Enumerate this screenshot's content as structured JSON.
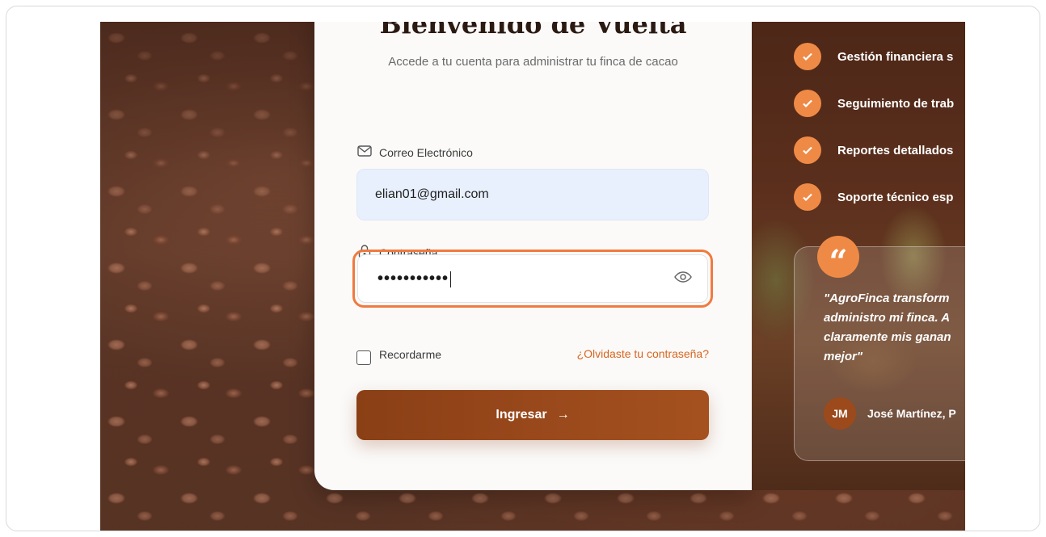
{
  "login": {
    "title": "Bienvenido de Vuelta",
    "subtitle": "Accede a tu cuenta para administrar tu finca de cacao",
    "email_label": "Correo Electrónico",
    "email_value": "elian01@gmail.com",
    "password_label": "Contraseña",
    "password_mask": "•••••••••••",
    "remember_label": "Recordarme",
    "forgot_label": "¿Olvidaste tu contraseña?",
    "submit_label": "Ingresar",
    "submit_arrow": "→"
  },
  "features": [
    {
      "label": "Gestión financiera s"
    },
    {
      "label": "Seguimiento de trab"
    },
    {
      "label": "Reportes detallados"
    },
    {
      "label": "Soporte técnico esp"
    }
  ],
  "testimonial": {
    "quote_mark": "“",
    "text": "\"AgroFinca transform\nadministro mi finca. A\nclaramente mis ganan\nmejor\"",
    "avatar_initials": "JM",
    "author": "José Martínez, P"
  },
  "colors": {
    "accent": "#ef8a46",
    "focus_ring": "#f07a3f",
    "button": "#9b4a1c",
    "link": "#d8651f",
    "email_fill": "#e8f0fe"
  },
  "icons": [
    "mail-icon",
    "lock-icon",
    "eye-icon",
    "check-icon",
    "arrow-right-icon",
    "quote-icon"
  ]
}
